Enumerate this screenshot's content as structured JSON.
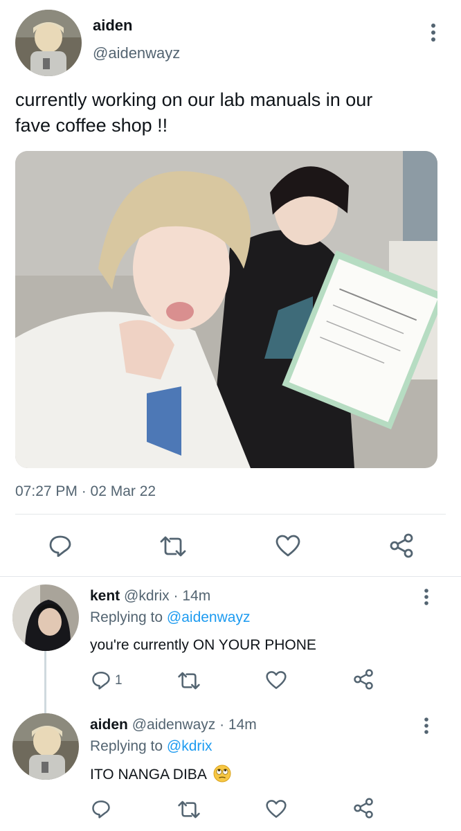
{
  "main_tweet": {
    "author_name": "aiden",
    "author_handle": "@aidenwayz",
    "text_line1": "currently working on our lab manuals in our",
    "text_line2": "fave coffee shop !!",
    "timestamp": "07:27 PM · 02 Mar 22",
    "actions": [
      "reply-icon",
      "retweet-icon",
      "like-icon",
      "share-icon"
    ]
  },
  "replies": [
    {
      "author_name": "kent",
      "author_handle": "@kdrix",
      "time": "· 14m",
      "replying_prefix": "Replying to",
      "replying_to": "@aidenwayz",
      "text": "you're currently ON YOUR PHONE",
      "reply_count": "1"
    },
    {
      "author_name": "aiden",
      "author_handle": "@aidenwayz",
      "time": "· 14m",
      "replying_prefix": "Replying to",
      "replying_to": "@kdrix",
      "text": "ITO NANGA DIBA",
      "emoji": "face-with-rolling-eyes"
    }
  ],
  "colors": {
    "link": "#1d9bf0",
    "muted": "#536471",
    "text": "#0f1419"
  }
}
